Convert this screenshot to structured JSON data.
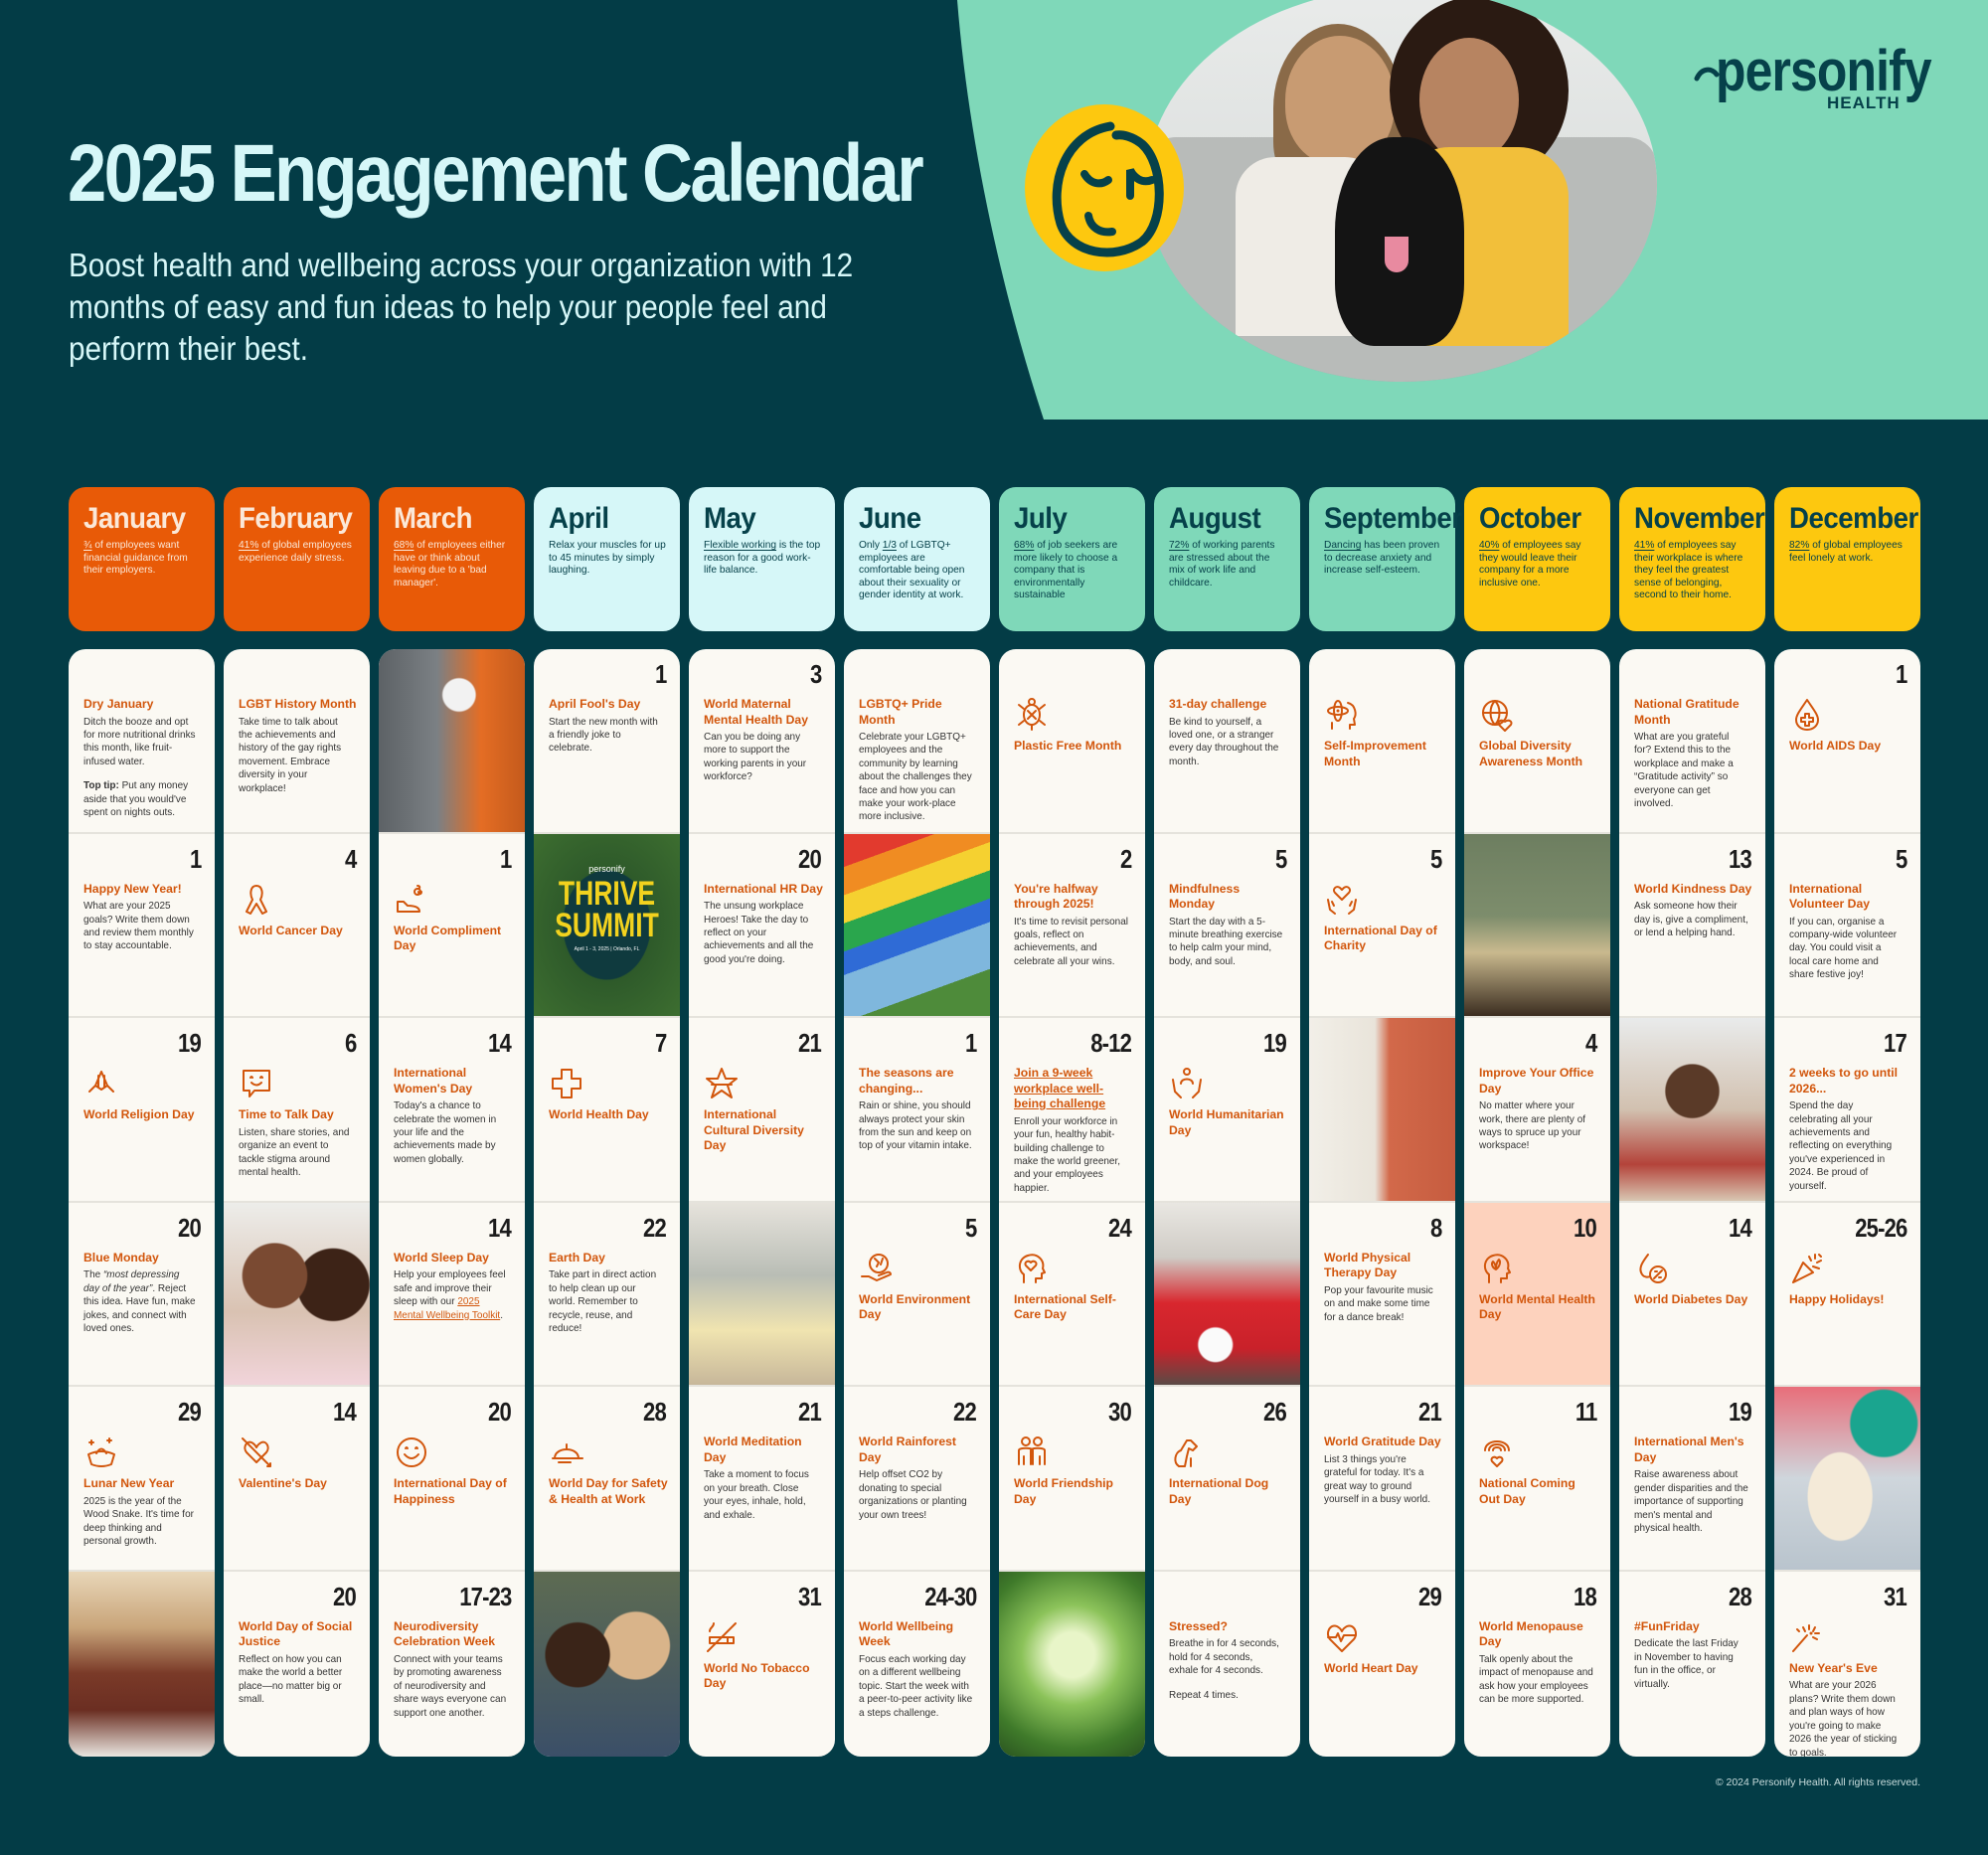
{
  "hero": {
    "title": "2025 Engagement Calendar",
    "subtitle": "Boost health and wellbeing across your organization with 12 months of easy and fun ideas to help your people feel and perform their best.",
    "logo_word": "personify",
    "logo_sub": "HEALTH",
    "photo_description": "Two smiling women hugging a black dog on a sofa"
  },
  "colors": {
    "background": "#033c46",
    "mint": "#7fd8b9",
    "orange": "#e85a07",
    "light_cyan": "#d6f7f8",
    "teal_green": "#7fd8b9",
    "yellow": "#fdc80f",
    "accent_text": "#d2560c",
    "cell_bg": "#fbf9f3",
    "highlight_cell": "#fdd2bd"
  },
  "months": [
    {
      "name": "January",
      "theme": "warm",
      "stat_highlight": "¾",
      "stat_rest": " of employees want financial guidance from their employers."
    },
    {
      "name": "February",
      "theme": "warm",
      "stat_highlight": "41%",
      "stat_rest": " of global employees experience daily stress."
    },
    {
      "name": "March",
      "theme": "warm",
      "stat_highlight": "68%",
      "stat_rest": " of employees either have or think about leaving due to a 'bad manager'."
    },
    {
      "name": "April",
      "theme": "cool",
      "stat_highlight": "",
      "stat_rest": "Relax your muscles for up to 45 minutes by simply laughing."
    },
    {
      "name": "May",
      "theme": "cool",
      "stat_highlight": "Flexible working",
      "stat_rest": " is the top reason for a good work-life balance."
    },
    {
      "name": "June",
      "theme": "cool",
      "stat_prefix": "Only ",
      "stat_highlight": "1/3",
      "stat_rest": " of LGBTQ+ employees are comfortable being open about their sexuality or gender identity at work."
    },
    {
      "name": "July",
      "theme": "green",
      "stat_highlight": "68%",
      "stat_rest": " of job seekers are more likely to choose a company that is environmentally sustainable"
    },
    {
      "name": "August",
      "theme": "green",
      "stat_highlight": "72%",
      "stat_rest": " of working parents are stressed about the mix of work life and childcare."
    },
    {
      "name": "September",
      "theme": "green",
      "stat_highlight": "Dancing",
      "stat_rest": " has been proven to decrease anxiety and increase self-esteem."
    },
    {
      "name": "October",
      "theme": "sun",
      "stat_highlight": "40%",
      "stat_rest": " of employees say they would leave their company for a more inclusive one."
    },
    {
      "name": "November",
      "theme": "sun",
      "stat_highlight": "41%",
      "stat_rest": " of employees say their workplace is where they feel the greatest sense of belonging, second to their home."
    },
    {
      "name": "December",
      "theme": "sun",
      "stat_highlight": "82%",
      "stat_rest": " of global employees feel lonely at work."
    }
  ],
  "columns": [
    [
      {
        "type": "event",
        "day": "",
        "title": "Dry January",
        "text": [
          "Ditch the booze and opt for more nutritional drinks this month, like fruit-infused water."
        ],
        "tip_label": "Top tip:",
        "tip": " Put any money aside that you would've spent on nights outs."
      },
      {
        "type": "event",
        "day": "1",
        "title": "Happy New Year!",
        "text": [
          "What are your 2025 goals? Write them down and review them monthly to stay accountable."
        ]
      },
      {
        "type": "event",
        "day": "19",
        "icon": "praying-hands-icon",
        "title": "World Religion Day"
      },
      {
        "type": "event",
        "day": "20",
        "title": "Blue Monday",
        "text_italic": "“most depressing day of the year”",
        "text_pre": "The ",
        "text": [
          ". Reject this idea. Have fun, make jokes, and connect with loved ones."
        ]
      },
      {
        "type": "event",
        "day": "29",
        "icon": "gold-ingot-icon",
        "title": "Lunar New Year",
        "text": [
          "2025 is the year of the Wood Snake. It's time for deep thinking and personal growth."
        ]
      },
      {
        "type": "photo",
        "photo": "man-reviewing-paperwork-at-laptop"
      }
    ],
    [
      {
        "type": "event",
        "day": "",
        "title": "LGBT History Month",
        "text": [
          "Take time to talk about the achievements and history of the gay rights movement. Embrace diversity in your workplace!"
        ]
      },
      {
        "type": "event",
        "day": "4",
        "icon": "awareness-ribbon-icon",
        "title": "World Cancer Day"
      },
      {
        "type": "event",
        "day": "6",
        "icon": "smiling-chat-bubble-icon",
        "title": "Time to Talk Day",
        "text": [
          "Listen, share stories, and organize an event to tackle stigma around mental health."
        ]
      },
      {
        "type": "photo",
        "photo": "grandmother-and-granddaughter-hugging"
      },
      {
        "type": "event",
        "day": "14",
        "icon": "heart-arrow-icon",
        "title": "Valentine's Day"
      },
      {
        "type": "event",
        "day": "20",
        "title": "World Day of Social Justice",
        "text": [
          "Reflect on how you can make the world a better place—no matter big or small."
        ]
      }
    ],
    [
      {
        "type": "photo",
        "photo": "engineer-with-laptop-and-robot-arm"
      },
      {
        "type": "event",
        "day": "1",
        "icon": "flower-hand-icon",
        "title": "World Compliment Day"
      },
      {
        "type": "event",
        "day": "14",
        "title": "International Women's Day",
        "text": [
          "Today's a chance to celebrate the women in your life and the achievements made by women globally."
        ]
      },
      {
        "type": "event",
        "day": "14",
        "title": "World Sleep Day",
        "text": [
          "Help your employees feel safe and improve their sleep with our "
        ],
        "link": "2025 Mental Wellbeing Toolkit",
        "text_after": "."
      },
      {
        "type": "event",
        "day": "20",
        "icon": "smiley-face-icon",
        "title": "International Day of Happiness"
      },
      {
        "type": "event",
        "day": "17-23",
        "title": "Neurodiversity Celebration Week",
        "text": [
          "Connect with your teams by promoting awareness of neurodiversity and share ways everyone can support one another."
        ]
      }
    ],
    [
      {
        "type": "event",
        "day": "1",
        "title": "April Fool's Day",
        "text": [
          "Start the new month with a friendly joke to celebrate."
        ]
      },
      {
        "type": "photo",
        "photo": "thrive-summit-poster",
        "poster_brand": "personify",
        "poster_line1": "THRIVE",
        "poster_line2": "SUMMIT",
        "poster_date": "April 1 - 3, 2025 | Orlando, FL"
      },
      {
        "type": "event",
        "day": "7",
        "icon": "medical-cross-icon",
        "title": "World Health Day"
      },
      {
        "type": "event",
        "day": "22",
        "title": "Earth Day",
        "text": [
          "Take part in direct action to help clean up our world. Remember to recycle, reuse, and reduce!"
        ]
      },
      {
        "type": "event",
        "day": "28",
        "icon": "hard-hat-icon",
        "title": "World Day for Safety & Health at Work"
      },
      {
        "type": "photo",
        "photo": "two-women-laughing"
      }
    ],
    [
      {
        "type": "event",
        "day": "3",
        "title": "World Maternal Mental Health Day",
        "text": [
          "Can you be doing any more to support the working parents in your workforce?"
        ]
      },
      {
        "type": "event",
        "day": "20",
        "title": "International HR Day",
        "text": [
          "The unsung workplace Heroes! Take the day to reflect on your achievements and all the good you're doing."
        ]
      },
      {
        "type": "event",
        "day": "21",
        "icon": "star-icon",
        "title": "International Cultural Diversity Day"
      },
      {
        "type": "photo",
        "photo": "two-people-stretching-at-home"
      },
      {
        "type": "event",
        "day": "21",
        "title": "World Meditation Day",
        "text": [
          "Take a moment to focus on your breath. Close your eyes, inhale, hold, and exhale."
        ]
      },
      {
        "type": "event",
        "day": "31",
        "icon": "no-smoking-icon",
        "title": "World No Tobacco Day"
      }
    ],
    [
      {
        "type": "event",
        "day": "",
        "title": "LGBTQ+ Pride Month",
        "text": [
          "Celebrate your LGBTQ+ employees and the community by learning about the challenges they face and how you can make your work-place more inclusive."
        ]
      },
      {
        "type": "photo",
        "photo": "pride-flag-raised-against-sky"
      },
      {
        "type": "event",
        "day": "1",
        "title": "The seasons are changing...",
        "text": [
          "Rain or shine, you should always protect your skin from the sun and keep on top of your vitamin intake."
        ]
      },
      {
        "type": "event",
        "day": "5",
        "icon": "globe-in-hand-icon",
        "title": "World Environment Day"
      },
      {
        "type": "event",
        "day": "22",
        "title": "World Rainforest Day",
        "text": [
          "Help offset CO2 by donating to special organizations or planting your own trees!"
        ]
      },
      {
        "type": "event",
        "day": "24-30",
        "title": "World Wellbeing Week",
        "text": [
          "Focus each working day on a different wellbeing topic. Start the week with a peer-to-peer activity like a steps challenge."
        ]
      }
    ],
    [
      {
        "type": "event",
        "day": "",
        "icon": "turtle-icon",
        "title": "Plastic Free Month"
      },
      {
        "type": "event",
        "day": "2",
        "title": "You're halfway through 2025!",
        "text": [
          "It's time to revisit personal goals, reflect on achievements, and celebrate all your wins."
        ]
      },
      {
        "type": "event",
        "day": "8-12",
        "title": "Join a 9-week workplace well-being challenge",
        "title_link": true,
        "text": [
          "Enroll your workforce in your fun, healthy habit-building challenge to make the world greener, and your employees happier."
        ]
      },
      {
        "type": "event",
        "day": "24",
        "icon": "heart-head-icon",
        "title": "International Self-Care Day"
      },
      {
        "type": "event",
        "day": "30",
        "icon": "friends-icon",
        "title": "World Friendship Day"
      },
      {
        "type": "photo",
        "photo": "forest-canopy-from-below"
      }
    ],
    [
      {
        "type": "event",
        "day": "",
        "title": "31-day challenge",
        "text": [
          "Be kind to yourself, a loved one, or a stranger every day throughout the month."
        ]
      },
      {
        "type": "event",
        "day": "5",
        "title": "Mindfulness Monday",
        "text": [
          "Start the day with a 5-minute breathing exercise to help calm your mind, body, and soul."
        ]
      },
      {
        "type": "event",
        "day": "19",
        "icon": "helping-hands-person-icon",
        "title": "World Humanitarian Day"
      },
      {
        "type": "photo",
        "photo": "father-and-child-with-football"
      },
      {
        "type": "event",
        "day": "26",
        "icon": "dog-icon",
        "title": "International Dog Day"
      },
      {
        "type": "event",
        "day": "",
        "title": "Stressed?",
        "text": [
          "Breathe in for 4 seconds, hold for 4 seconds, exhale for 4 seconds."
        ],
        "text2": "Repeat 4 times."
      }
    ],
    [
      {
        "type": "event",
        "day": "",
        "icon": "atom-head-icon",
        "title": "Self-Improvement Month"
      },
      {
        "type": "event",
        "day": "5",
        "icon": "heart-in-hands-icon",
        "title": "International Day of Charity"
      },
      {
        "type": "photo",
        "photo": "mother-and-daughter-dancing-in-kitchen"
      },
      {
        "type": "event",
        "day": "8",
        "title": "World Physical Therapy Day",
        "text": [
          "Pop your favourite music on and make some time for a dance break!"
        ]
      },
      {
        "type": "event",
        "day": "21",
        "title": "World Gratitude Day",
        "text": [
          "List 3 things you're grateful for today. It's a great way to ground yourself in a busy world."
        ]
      },
      {
        "type": "event",
        "day": "29",
        "icon": "heartbeat-icon",
        "title": "World Heart Day"
      }
    ],
    [
      {
        "type": "event",
        "day": "",
        "icon": "globe-heart-icon",
        "title": "Global Diversity Awareness Month"
      },
      {
        "type": "photo",
        "photo": "diverse-group-of-coworkers"
      },
      {
        "type": "event",
        "day": "4",
        "title": "Improve Your Office Day",
        "text": [
          "No matter where your work, there are plenty of ways to spruce up your workspace!"
        ]
      },
      {
        "type": "event",
        "day": "10",
        "icon": "lotus-head-icon",
        "title": "World Mental Health Day",
        "highlight": true
      },
      {
        "type": "event",
        "day": "11",
        "icon": "rainbow-heart-icon",
        "title": "National Coming Out Day"
      },
      {
        "type": "event",
        "day": "18",
        "title": "World Menopause Day",
        "text": [
          "Talk openly about the impact of menopause and ask how your employees can be more supported."
        ]
      }
    ],
    [
      {
        "type": "event",
        "day": "",
        "title": "National Gratitude Month",
        "text": [
          "What are you grateful for? Extend this to the workplace and make a “Gratitude activity” so everyone can get involved."
        ]
      },
      {
        "type": "event",
        "day": "13",
        "title": "World Kindness Day",
        "text": [
          "Ask someone how their day is, give a compliment, or lend a helping hand."
        ]
      },
      {
        "type": "photo",
        "photo": "team-hands-together-celebrating"
      },
      {
        "type": "event",
        "day": "14",
        "icon": "diabetes-drop-icon",
        "title": "World Diabetes Day"
      },
      {
        "type": "event",
        "day": "19",
        "title": "International Men's Day",
        "text": [
          "Raise awareness about gender disparities and the importance of supporting men's mental and physical health."
        ]
      },
      {
        "type": "event",
        "day": "28",
        "title": "#FunFriday",
        "text": [
          "Dedicate the last Friday in November to having fun in the office, or virtually."
        ]
      }
    ],
    [
      {
        "type": "event",
        "day": "1",
        "icon": "blood-drop-cross-icon",
        "title": "World AIDS Day"
      },
      {
        "type": "event",
        "day": "5",
        "title": "International Volunteer Day",
        "text": [
          "If you can, organise a company-wide volunteer day. You could visit a local care home and share festive joy!"
        ]
      },
      {
        "type": "event",
        "day": "17",
        "title": "2 weeks to go until 2026...",
        "text": [
          "Spend the day celebrating all your achievements and reflecting on everything you've experienced in 2024. Be proud of yourself."
        ]
      },
      {
        "type": "event",
        "day": "25-26",
        "icon": "party-popper-icon",
        "title": "Happy Holidays!"
      },
      {
        "type": "photo",
        "photo": "dog-with-party-hat"
      },
      {
        "type": "event",
        "day": "31",
        "icon": "sparkler-icon",
        "title": "New Year's Eve",
        "text": [
          "What are your 2026 plans? Write them down and plan ways of how you're going to make 2026 the year of sticking to goals."
        ]
      }
    ]
  ],
  "footer": {
    "copyright": "© 2024 Personify Health. All rights reserved."
  }
}
